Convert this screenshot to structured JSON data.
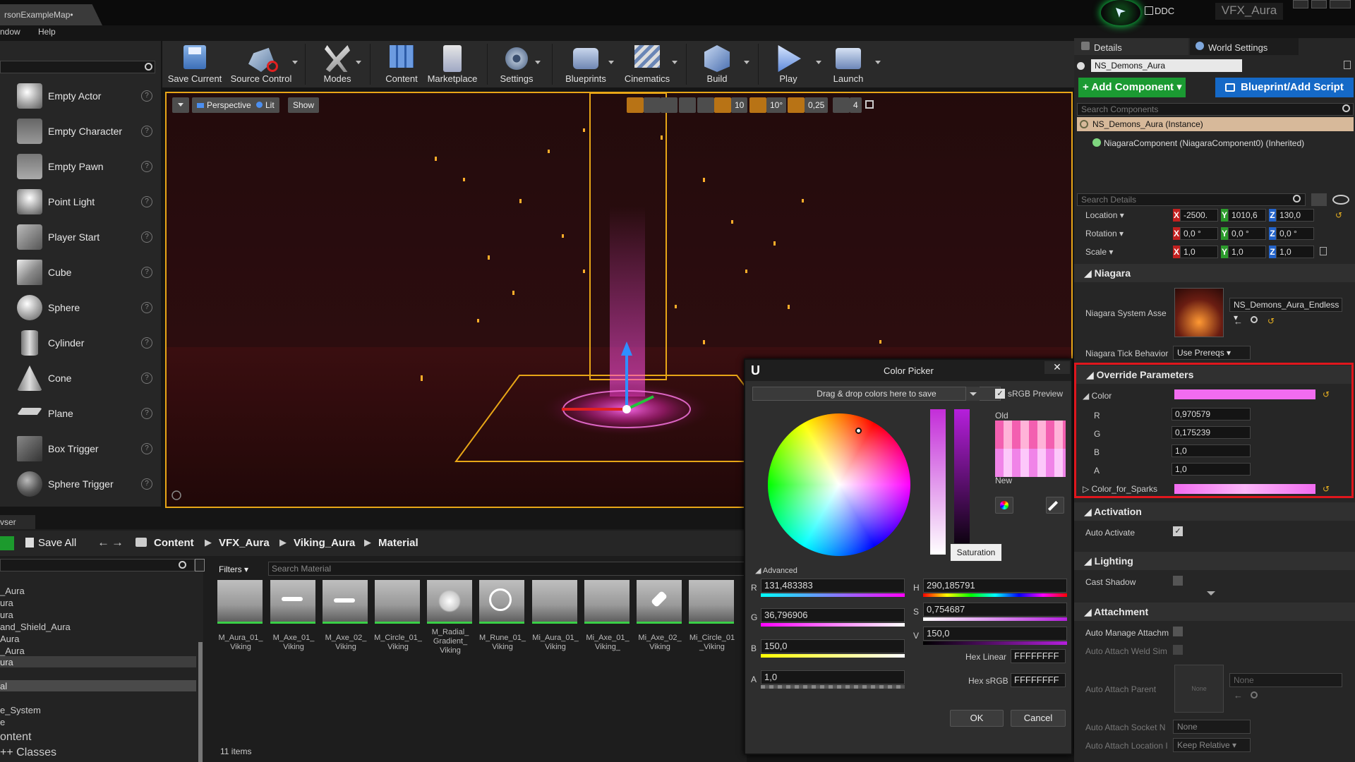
{
  "titlebar": {
    "map_tab": "rsonExampleMap•",
    "ddc_label": "DDC",
    "project_name": "VFX_Aura"
  },
  "menu": {
    "items": [
      "ndow",
      "Help"
    ]
  },
  "modes": {
    "items": [
      {
        "label": "Empty Actor",
        "icon": "sphere-icon"
      },
      {
        "label": "Empty Character",
        "icon": "character-icon"
      },
      {
        "label": "Empty Pawn",
        "icon": "pawn-icon"
      },
      {
        "label": "Point Light",
        "icon": "light-bulb-icon"
      },
      {
        "label": "Player Start",
        "icon": "player-start-icon"
      },
      {
        "label": "Cube",
        "icon": "cube-icon"
      },
      {
        "label": "Sphere",
        "icon": "sphere-icon"
      },
      {
        "label": "Cylinder",
        "icon": "cylinder-icon"
      },
      {
        "label": "Cone",
        "icon": "cone-icon"
      },
      {
        "label": "Plane",
        "icon": "plane-icon"
      },
      {
        "label": "Box Trigger",
        "icon": "box-trigger-icon"
      },
      {
        "label": "Sphere Trigger",
        "icon": "sphere-trigger-icon"
      }
    ]
  },
  "toolbar": {
    "buttons": [
      {
        "label": "Save Current",
        "icon": "save-icon"
      },
      {
        "label": "Source Control",
        "icon": "source-control-icon"
      },
      {
        "label": "Modes",
        "icon": "modes-icon"
      },
      {
        "label": "Content",
        "icon": "content-icon"
      },
      {
        "label": "Marketplace",
        "icon": "marketplace-icon"
      },
      {
        "label": "Settings",
        "icon": "settings-icon"
      },
      {
        "label": "Blueprints",
        "icon": "blueprints-icon"
      },
      {
        "label": "Cinematics",
        "icon": "cinematics-icon"
      },
      {
        "label": "Build",
        "icon": "build-icon"
      },
      {
        "label": "Play",
        "icon": "play-icon"
      },
      {
        "label": "Launch",
        "icon": "launch-icon"
      }
    ]
  },
  "viewport": {
    "perspective": "Perspective",
    "lit": "Lit",
    "show": "Show",
    "grid_snap": "10",
    "rot_snap": "10°",
    "scale_snap": "0,25",
    "camera_speed": "4"
  },
  "content_browser": {
    "tab_label": "vser",
    "save_all": "Save All",
    "breadcrumb": [
      "Content",
      "VFX_Aura",
      "Viking_Aura",
      "Material"
    ],
    "filters": "Filters",
    "search_placeholder": "Search Material",
    "tree": [
      "_Aura",
      "ura",
      "ura",
      "and_Shield_Aura",
      "Aura",
      "_Aura",
      "ura",
      "al",
      "e_System",
      "e",
      "ontent",
      "++ Classes"
    ],
    "assets": [
      "M_Aura_01_ Viking",
      "M_Axe_01_ Viking",
      "M_Axe_02_ Viking",
      "M_Circle_01_ Viking",
      "M_Radial_ Gradient_ Viking",
      "M_Rune_01_ Viking",
      "Mi_Aura_01_ Viking",
      "Mi_Axe_01_ Viking_",
      "Mi_Axe_02_ Viking",
      "Mi_Circle_01 _Viking"
    ],
    "item_count": "11 items"
  },
  "color_picker": {
    "title": "Color Picker",
    "drag_drop": "Drag & drop colors here to save",
    "srgb_preview": "sRGB Preview",
    "old_label": "Old",
    "new_label": "New",
    "saturation_tooltip": "Saturation",
    "advanced": "Advanced",
    "r_label": "R",
    "r_value": "131,483383",
    "g_label": "G",
    "g_value": "36,796906",
    "b_label": "B",
    "b_value": "150,0",
    "a_label": "A",
    "a_value": "1,0",
    "h_label": "H",
    "h_value": "290,185791",
    "s_label": "S",
    "s_value": "0,754687",
    "v_label": "V",
    "v_value": "150,0",
    "hex_linear_label": "Hex Linear",
    "hex_linear": "FFFFFFFF",
    "hex_srgb_label": "Hex sRGB",
    "hex_srgb": "FFFFFFFF",
    "ok": "OK",
    "cancel": "Cancel",
    "old_color": "#f35fb0",
    "new_color": "#f084e8"
  },
  "details": {
    "tab_details": "Details",
    "tab_world": "World Settings",
    "actor_name": "NS_Demons_Aura",
    "add_component": "+ Add Component",
    "blueprint_script": "Blueprint/Add Script",
    "search_components": "Search Components",
    "instance": "NS_Demons_Aura (Instance)",
    "niagara_component": "NiagaraComponent (NiagaraComponent0) (Inherited)",
    "search_details": "Search Details",
    "location_label": "Location",
    "location": [
      "-2500.",
      "1010,6",
      "130,0"
    ],
    "rotation_label": "Rotation",
    "rotation": [
      "0,0 °",
      "0,0 °",
      "0,0 °"
    ],
    "scale_label": "Scale",
    "scale": [
      "1,0",
      "1,0",
      "1,0"
    ],
    "niagara_section": "Niagara",
    "niagara_system_label": "Niagara System Asse",
    "niagara_system_value": "NS_Demons_Aura_Endless",
    "tick_label": "Niagara Tick Behavior",
    "tick_value": "Use Prereqs",
    "override_section": "Override Parameters",
    "color_label": "Color",
    "color_r_label": "R",
    "color_r": "0,970579",
    "color_g_label": "G",
    "color_g": "0,175239",
    "color_b_label": "B",
    "color_b": "1,0",
    "color_a_label": "A",
    "color_a": "1,0",
    "sparks_label": "Color_for_Sparks",
    "activation_section": "Activation",
    "auto_activate": "Auto Activate",
    "lighting_section": "Lighting",
    "cast_shadow": "Cast Shadow",
    "attachment_section": "Attachment",
    "auto_manage": "Auto Manage Attachm",
    "auto_weld": "Auto Attach Weld Sim",
    "auto_parent": "Auto Attach Parent",
    "none1": "None",
    "none2": "None",
    "auto_socket": "Auto Attach Socket N",
    "socket_value": "None",
    "auto_location": "Auto Attach Location I",
    "location_rule": "Keep Relative",
    "accent_color": "#f26cf0",
    "highlight_color": "#e0161d"
  }
}
